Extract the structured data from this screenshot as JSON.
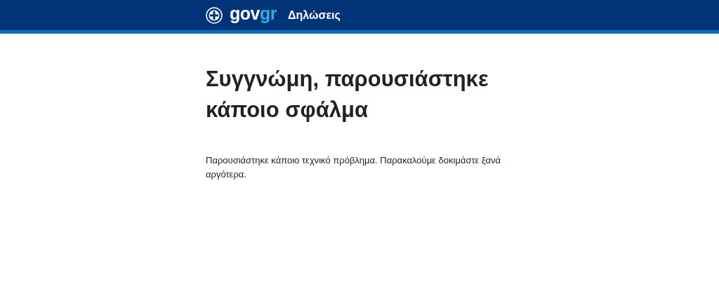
{
  "header": {
    "logo": {
      "part_1": "gov",
      "part_2": "gr"
    },
    "service": "Δηλώσεις"
  },
  "title": "Συγγνώμη, παρουσιάστηκε κάποιο σφάλμα",
  "message": "Παρουσιάστηκε κάποιο τεχνικό πρόβλημα. Παρακαλούμε δοκιμάστε ξανά αργότερα."
}
